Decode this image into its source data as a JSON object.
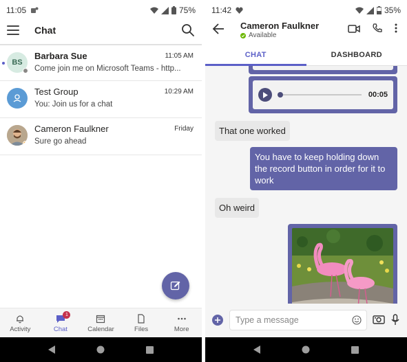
{
  "left": {
    "status": {
      "time": "11:05",
      "battery": "75%"
    },
    "header": {
      "title": "Chat"
    },
    "chats": [
      {
        "initials": "BS",
        "name": "Barbara Sue",
        "time": "11:05 AM",
        "preview": "Come join me on Microsoft Teams - http...",
        "unread": true
      },
      {
        "initials": "",
        "name": "Test Group",
        "time": "10:29 AM",
        "preview": "You: Join us for a chat",
        "unread": false
      },
      {
        "initials": "",
        "name": "Cameron Faulkner",
        "time": "Friday",
        "preview": "Sure go ahead",
        "unread": false
      }
    ],
    "nav": [
      {
        "label": "Activity",
        "icon": "bell-icon"
      },
      {
        "label": "Chat",
        "icon": "chat-icon",
        "badge": "1",
        "active": true
      },
      {
        "label": "Calendar",
        "icon": "calendar-icon"
      },
      {
        "label": "Files",
        "icon": "file-icon"
      },
      {
        "label": "More",
        "icon": "more-icon"
      }
    ]
  },
  "right": {
    "status": {
      "time": "11:42",
      "battery": "35%"
    },
    "header": {
      "name": "Cameron Faulkner",
      "presence": "Available"
    },
    "tabs": {
      "chat": "CHAT",
      "dashboard": "DASHBOARD"
    },
    "messages": {
      "audio_duration": "00:05",
      "m1": "That one worked",
      "m2": "You have to keep holding down the record button in order for it to work",
      "m3": "Oh weird"
    },
    "composer": {
      "placeholder": "Type a message"
    }
  },
  "colors": {
    "accent": "#6264a7",
    "accent_text": "#5b5fc7",
    "badge": "#c4314b",
    "available": "#6bb700"
  }
}
